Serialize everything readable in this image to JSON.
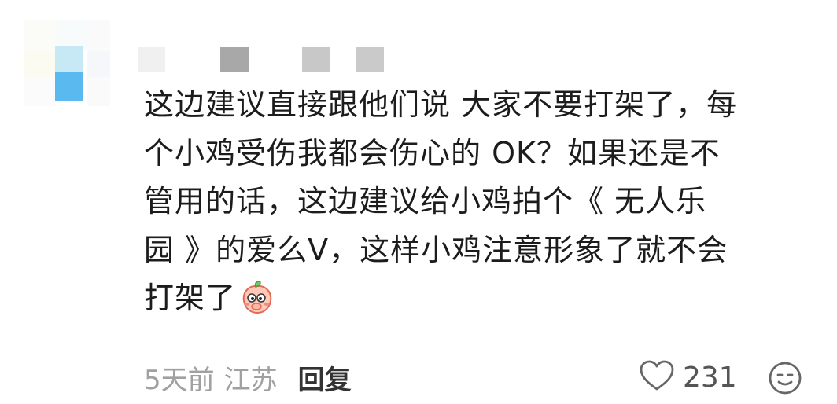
{
  "comment": {
    "lines": [
      "这边建议直接跟他们说 大家不要打架了，每",
      "个小鸡受伤我都会伤心的 OK？如果还是不",
      "管用的话，这边建议给小鸡拍个《 无人乐",
      "园 》的爱么V，这样小鸡注意形象了就不会",
      "打架了"
    ],
    "emoji_icon": "blushing-peach-emoji-icon"
  },
  "meta": {
    "time": "5天前",
    "location": "江苏",
    "reply_label": "回复"
  },
  "like": {
    "icon": "heart-outline-icon",
    "count": "231"
  },
  "reaction": {
    "icon": "smiley-face-icon"
  },
  "colors": {
    "text": "#1c1c1c",
    "meta_text": "#a0a0a0",
    "reply_text": "#333333",
    "icon_stroke": "#666666"
  }
}
